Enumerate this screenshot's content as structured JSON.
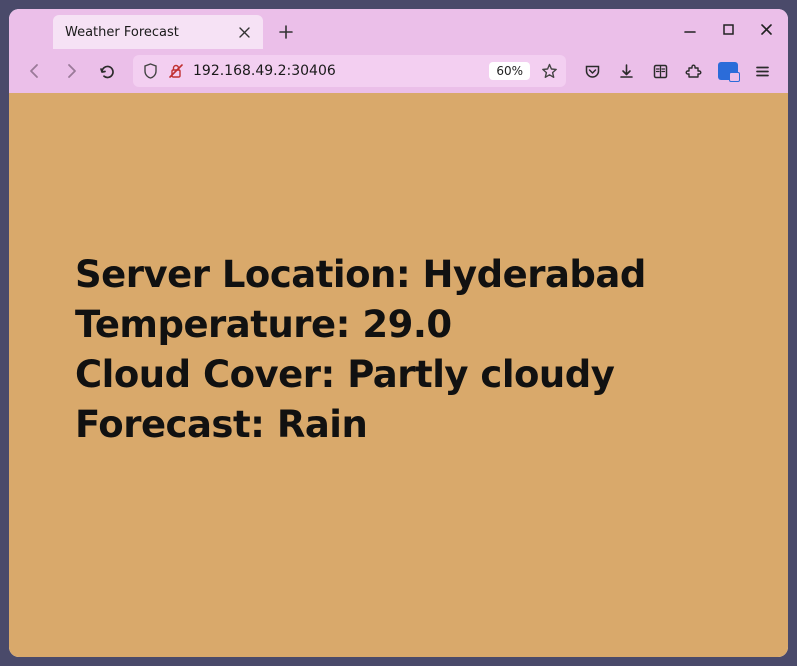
{
  "tab": {
    "title": "Weather Forecast"
  },
  "addr": {
    "url": "192.168.49.2:30406",
    "zoom": "60%"
  },
  "page": {
    "labels": {
      "location": "Server Location: ",
      "temperature": "Temperature: ",
      "cloud": "Cloud Cover: ",
      "forecast": "Forecast: "
    },
    "values": {
      "location": "Hyderabad",
      "temperature": "29.0",
      "cloud": "Partly cloudy",
      "forecast": "Rain"
    }
  }
}
